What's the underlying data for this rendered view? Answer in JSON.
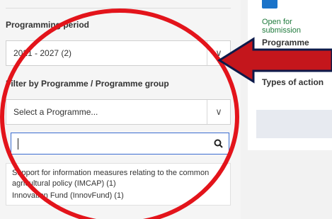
{
  "filters": {
    "period_label": "Programming period",
    "period_value": "2021 - 2027 (2)",
    "programme_label": "Filter by Programme / Programme group",
    "programme_placeholder": "Select a Programme...",
    "search_value": "",
    "options": [
      "Support for information measures relating to the common agricultural policy (IMCAP) (1)",
      "Innovation Fund (InnovFund) (1)"
    ]
  },
  "result_card": {
    "status": "Open for submission",
    "programme_label": "Programme",
    "types_label": "Types of action"
  },
  "colors": {
    "annotation": "#e3141b",
    "accent": "#1a73c9",
    "status_green": "#1f7a3c"
  },
  "icons": [
    "chevron-down-icon",
    "search-icon"
  ]
}
